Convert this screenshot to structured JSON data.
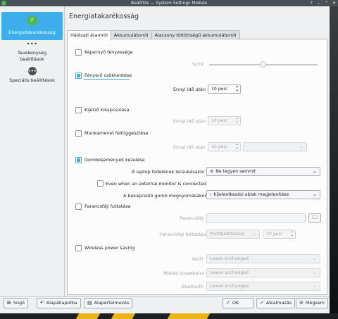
{
  "window": {
    "title": "Beállítás — System Settings Module"
  },
  "sidebar": {
    "items": [
      {
        "label": "Energiatakarékosság",
        "icon": "energy-icon"
      },
      {
        "label": "Tevékenység\nbeállítások",
        "line1": "Tevékenység",
        "line2": "beállítások",
        "icon": "dots-icon"
      },
      {
        "label": "Speciális beállítások",
        "icon": "special-icon"
      }
    ]
  },
  "page": {
    "title": "Energiatakarékosság"
  },
  "tabs": [
    {
      "label": "Hálózati áramról",
      "active": true
    },
    {
      "label": "Akkumulátorról",
      "active": false
    },
    {
      "label": "Alacsony töltöttségű akkumulátorról",
      "active": false
    }
  ],
  "settings": {
    "brightness": {
      "label": "Képernyő fényessége",
      "checked": false,
      "level_label": "Szint",
      "level_fraction": 0.5
    },
    "dim": {
      "label": "Fényerő csökkentése",
      "checked": true,
      "after_label": "Ennyi idő után",
      "after_value": "10 perc"
    },
    "screen_off": {
      "label": "Kijelző kikapcsolása",
      "checked": false,
      "after_label": "Ennyi idő után",
      "after_value": "10 perc"
    },
    "suspend": {
      "label": "Munkamenet felfüggesztése",
      "checked": false,
      "after_label": "Ennyi idő után",
      "after_value": "10 perc",
      "action_value": ""
    },
    "buttons": {
      "label": "Gombesemények kezelése",
      "checked": true,
      "lid_label": "A laptop fedelének lecsukásakor",
      "lid_value": "Ne tegyen semmit",
      "external_monitor_label": "Even when an external monitor is connected",
      "external_monitor_checked": false,
      "power_label": "A bekapcsoló gomb megnyomásakor",
      "power_value": "Kijelentkezési ablak megjelenítése"
    },
    "script": {
      "label": "Parancsfájl futtatása",
      "checked": false,
      "file_label": "Parancsfájl",
      "file_value": "",
      "run_label": "Parancsfájl futtatása",
      "run_value": "Profilbetöltéskor",
      "run_delay": "10 perc"
    },
    "wireless": {
      "label": "Wireless power saving",
      "checked": false,
      "wifi_label": "Wi-Fi",
      "wifi_value": "Leave unchanged",
      "mobile_label": "Mobile broadband",
      "mobile_value": "Leave unchanged",
      "bluetooth_label": "Bluetooth",
      "bluetooth_value": "Leave unchanged"
    }
  },
  "footer": {
    "help": "Súgó",
    "reset": "Alapállapotba",
    "defaults": "Alapértelmezés",
    "ok": "OK",
    "apply": "Alkalmazás",
    "cancel": "Mégsem"
  },
  "colors": {
    "accent": "#3daee9",
    "energy_icon": "#4fb84a"
  }
}
